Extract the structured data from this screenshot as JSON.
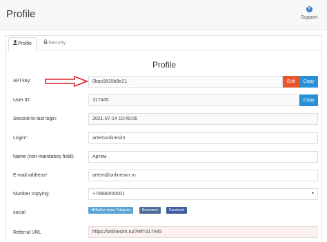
{
  "header": {
    "title": "Profile",
    "support_icon_glyph": "?",
    "support_label": "Support"
  },
  "tabs": [
    {
      "label": "Profile",
      "icon": "user-icon"
    },
    {
      "label": "Security",
      "icon": "lock-icon"
    }
  ],
  "profile": {
    "section_title": "Profile",
    "api_key": {
      "label": "API key:",
      "value": "0bac9815b8e21·",
      "edit_label": "Edit",
      "copy_label": "Copy"
    },
    "user_id": {
      "label": "User ID:",
      "value": "317445",
      "copy_label": "Copy"
    },
    "second_last_login": {
      "label": "Second-to-last login:",
      "value": "2021-07-14 10:49:06"
    },
    "login": {
      "label": "Login*:",
      "value": "artemonlinesim"
    },
    "name": {
      "label": "Name (non-mandatory field):",
      "value": "Артем"
    },
    "email": {
      "label": "E-mail address*:",
      "value": "artem@onlinesim.ru"
    },
    "number_copying": {
      "label": "Number copying:",
      "value": "+79990000001"
    },
    "social": {
      "label": "social",
      "buttons": [
        {
          "label": "Войти через Telegram",
          "color": "#5aa4d8"
        },
        {
          "label": "Вконтакте",
          "color": "#4c6e96"
        },
        {
          "label": "Facebook",
          "color": "#3f5f9c"
        }
      ]
    },
    "referral": {
      "label": "Referral URL",
      "value": "https://onlinesim.ru/?ref=317445"
    }
  },
  "colors": {
    "edit": "#e8562a",
    "copy": "#2b8fd6",
    "arrow": "#d9232a"
  }
}
